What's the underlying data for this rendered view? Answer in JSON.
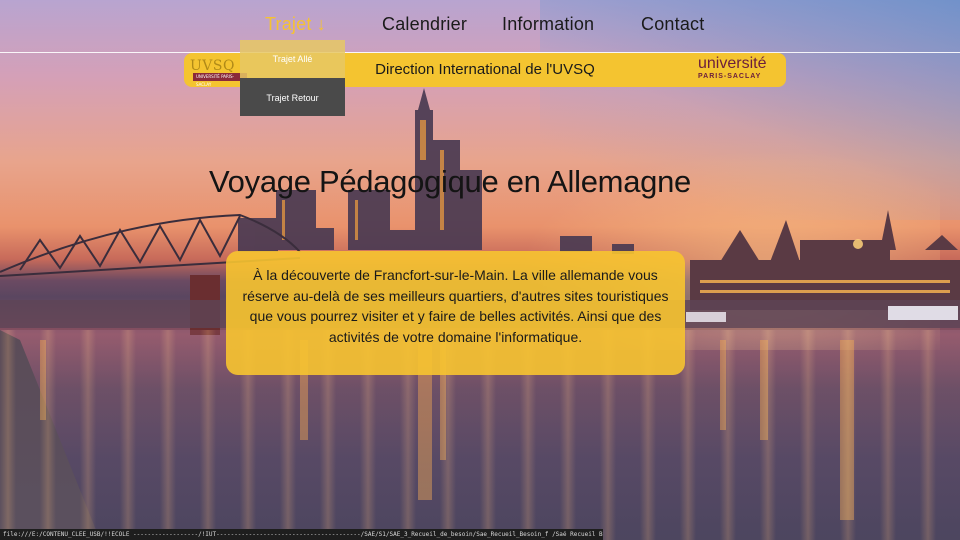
{
  "nav": {
    "items": [
      {
        "label": "Trajet",
        "arrow": "↓",
        "active": true
      },
      {
        "label": "Calendrier"
      },
      {
        "label": "Information"
      },
      {
        "label": "Contact"
      }
    ]
  },
  "dropdown": {
    "items": [
      {
        "label": "Trajet Allé"
      },
      {
        "label": "Trajet Retour"
      }
    ]
  },
  "banner": {
    "left_logo_text": "UVSQ",
    "left_logo_sub": "UNIVERSITÉ PARIS-SACLAY",
    "title": "Direction International de l'UVSQ",
    "right_logo_line1": "université",
    "right_logo_line2": "PARIS-SACLAY"
  },
  "hero": {
    "title": "Voyage Pédagogique en Allemagne"
  },
  "card": {
    "text": "À la découverte de Francfort-sur-le-Main. La ville allemande vous réserve au-delà de ses meilleurs quartiers, d'autres sites touristiques que vous pourrez visiter et y faire de belles activités. Ainsi que des activités de votre domaine l'informatique."
  },
  "status": {
    "url": "file:///E:/CONTENU_CLEE_USB/!!ECOLE ------------------/!IUT----------------------------------------/SAE/S1/SAE_3_Recueil_de_besoin/Sae_Recueil_Besoin_f                        /Saé Recueil Besoin/Trajet_allé.html"
  },
  "colors": {
    "accent": "#f4c430",
    "brand_dark": "#6b1e3c"
  }
}
